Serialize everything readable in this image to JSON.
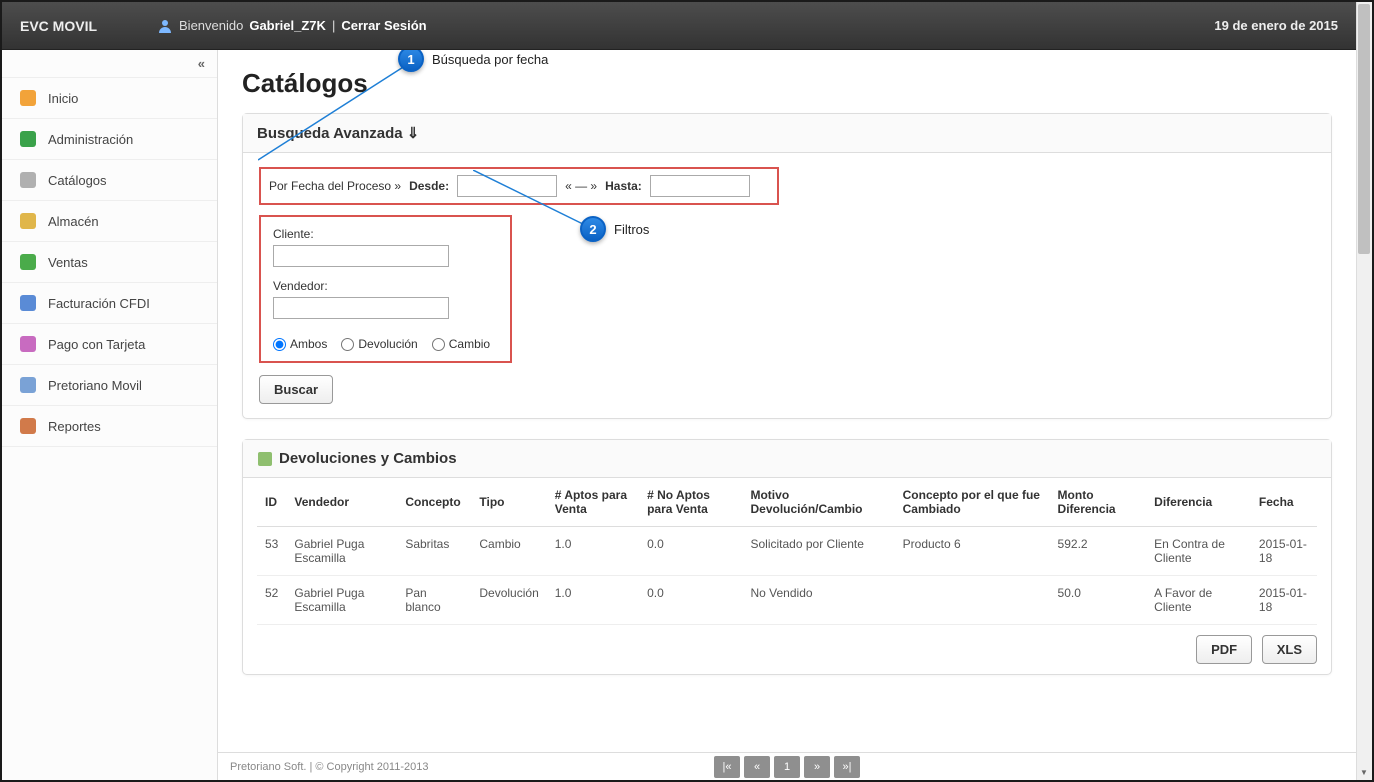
{
  "header": {
    "brand": "EVC MOVIL",
    "welcome_prefix": "Bienvenido",
    "username": "Gabriel_Z7K",
    "logout_label": "Cerrar Sesión",
    "date": "19 de enero de 2015"
  },
  "sidebar": {
    "collapse_glyph": "«",
    "items": [
      {
        "label": "Inicio",
        "icon": "home-icon",
        "color": "#f2a33a"
      },
      {
        "label": "Administración",
        "icon": "admin-icon",
        "color": "#3aa24a"
      },
      {
        "label": "Catálogos",
        "icon": "catalog-icon",
        "color": "#b0b0b0"
      },
      {
        "label": "Almacén",
        "icon": "warehouse-icon",
        "color": "#e0b64a"
      },
      {
        "label": "Ventas",
        "icon": "sales-icon",
        "color": "#4aab4a"
      },
      {
        "label": "Facturación CFDI",
        "icon": "invoice-icon",
        "color": "#5a8bd6"
      },
      {
        "label": "Pago con Tarjeta",
        "icon": "card-icon",
        "color": "#c86bc0"
      },
      {
        "label": "Pretoriano Movil",
        "icon": "mobile-icon",
        "color": "#7aa2d6"
      },
      {
        "label": "Reportes",
        "icon": "reports-icon",
        "color": "#d17a4a"
      }
    ]
  },
  "page": {
    "title": "Catálogos",
    "search_panel_title": "Busqueda Avanzada ⇓",
    "date_filter_label": "Por Fecha del Proceso »",
    "desde_label": "Desde:",
    "range_sep": "« — »",
    "hasta_label": "Hasta:",
    "cliente_label": "Cliente:",
    "vendedor_label": "Vendedor:",
    "radios": {
      "ambos": "Ambos",
      "devolucion": "Devolución",
      "cambio": "Cambio"
    },
    "search_button": "Buscar",
    "results_panel_title": "Devoluciones y Cambios",
    "export_pdf": "PDF",
    "export_xls": "XLS"
  },
  "callouts": {
    "c1": {
      "num": "1",
      "text": "Búsqueda por fecha"
    },
    "c2": {
      "num": "2",
      "text": "Filtros"
    }
  },
  "table": {
    "headers": [
      "ID",
      "Vendedor",
      "Concepto",
      "Tipo",
      "# Aptos para Venta",
      "# No Aptos para Venta",
      "Motivo Devolución/Cambio",
      "Concepto por el que fue Cambiado",
      "Monto Diferencia",
      "Diferencia",
      "Fecha"
    ],
    "rows": [
      {
        "id": "53",
        "vendedor": "Gabriel Puga Escamilla",
        "concepto": "Sabritas",
        "tipo": "Cambio",
        "aptos": "1.0",
        "noaptos": "0.0",
        "motivo": "Solicitado por Cliente",
        "concepto_cambio": "Producto 6",
        "monto": "592.2",
        "dif": "En Contra de Cliente",
        "fecha": "2015-01-18"
      },
      {
        "id": "52",
        "vendedor": "Gabriel Puga Escamilla",
        "concepto": "Pan blanco",
        "tipo": "Devolución",
        "aptos": "1.0",
        "noaptos": "0.0",
        "motivo": "No Vendido",
        "concepto_cambio": "",
        "monto": "50.0",
        "dif": "A Favor de Cliente",
        "fecha": "2015-01-18"
      }
    ]
  },
  "pager": {
    "first": "|«",
    "prev": "«",
    "page": "1",
    "next": "»",
    "last": "»|"
  },
  "footer": {
    "text": "Pretoriano Soft. | © Copyright 2011-2013"
  }
}
